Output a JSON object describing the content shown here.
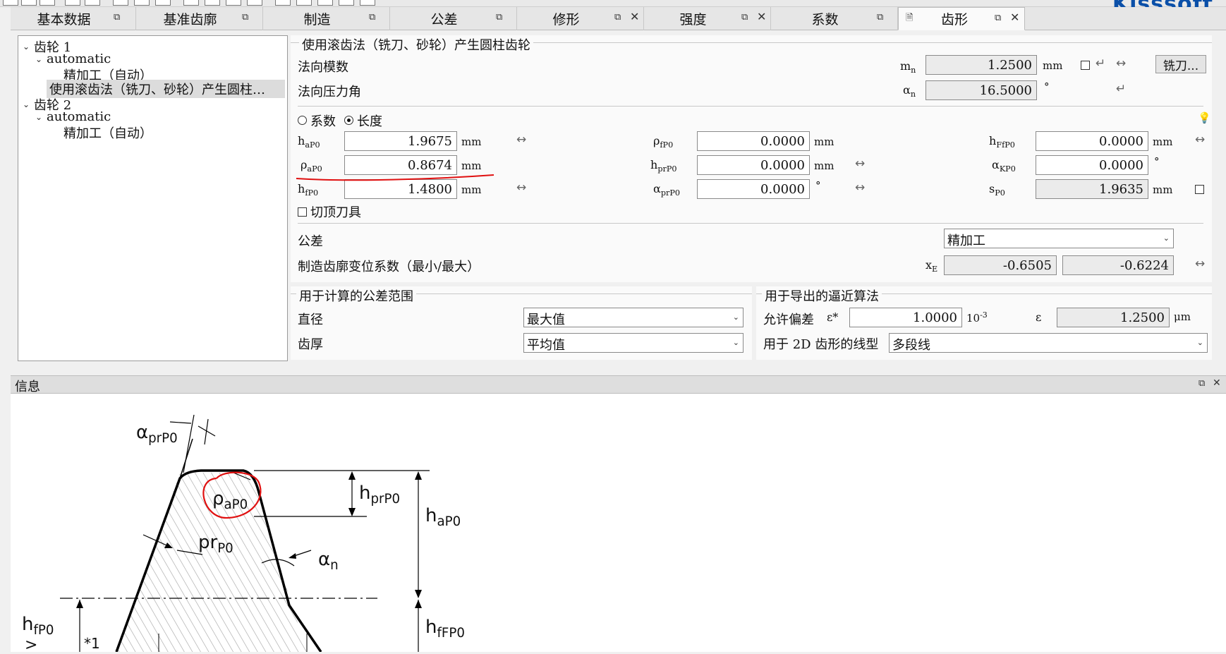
{
  "window": {
    "logo": "Kisssoft"
  },
  "tabs": [
    {
      "label": "基本数据",
      "float": true,
      "close": false
    },
    {
      "label": "基准齿廓",
      "float": true,
      "close": false
    },
    {
      "label": "制造",
      "float": true,
      "close": false
    },
    {
      "label": "公差",
      "float": true,
      "close": false
    },
    {
      "label": "修形",
      "float": true,
      "close": true
    },
    {
      "label": "强度",
      "float": true,
      "close": true
    },
    {
      "label": "系数",
      "float": true,
      "close": false
    },
    {
      "label": "齿形",
      "float": true,
      "close": true,
      "active": true
    }
  ],
  "tree": {
    "gear1": "齿轮 1",
    "auto1": "automatic",
    "fin1": "精加工（自动）",
    "hob1": "使用滚齿法（铣刀、砂轮）产生圆柱…",
    "gear2": "齿轮 2",
    "auto2": "automatic",
    "fin2": "精加工（自动）"
  },
  "main": {
    "group_title": "使用滚齿法（铣刀、砂轮）产生圆柱齿轮",
    "normal_module": {
      "label": "法向模数",
      "symbol": "m",
      "sub": "n",
      "value": "1.2500",
      "unit": "mm"
    },
    "pressure_angle": {
      "label": "法向压力角",
      "symbol": "α",
      "sub": "n",
      "value": "16.5000",
      "unit": "°"
    },
    "cutter_button": "铣刀...",
    "mode": {
      "coef": "系数",
      "length": "长度",
      "selected": "length"
    },
    "params": {
      "haP0": {
        "symbol": "h",
        "sub": "aP0",
        "value": "1.9675",
        "unit": "mm"
      },
      "rhoaP0": {
        "symbol": "ρ",
        "sub": "aP0",
        "value": "0.8674",
        "unit": "mm"
      },
      "hfP0": {
        "symbol": "h",
        "sub": "fP0",
        "value": "1.4800",
        "unit": "mm"
      },
      "rhofP0": {
        "symbol": "ρ",
        "sub": "fP0",
        "value": "0.0000",
        "unit": "mm"
      },
      "hprP0": {
        "symbol": "h",
        "sub": "prP0",
        "value": "0.0000",
        "unit": "mm"
      },
      "alphaprP0": {
        "symbol": "α",
        "sub": "prP0",
        "value": "0.0000",
        "unit": "°"
      },
      "hFfP0": {
        "symbol": "h",
        "sub": "FfP0",
        "value": "0.0000",
        "unit": "mm"
      },
      "alphaKP0": {
        "symbol": "α",
        "sub": "KP0",
        "value": "0.0000",
        "unit": "°"
      },
      "sP0": {
        "symbol": "s",
        "sub": "P0",
        "value": "1.9635",
        "unit": "mm"
      }
    },
    "tip_relief": "切顶刀具",
    "tolerance": {
      "label": "公差",
      "value": "精加工"
    },
    "shift": {
      "label": "制造齿廓变位系数（最小/最大）",
      "symbol": "x",
      "sub": "E",
      "min": "-0.6505",
      "max": "-0.6224"
    }
  },
  "tolerance_range": {
    "title": "用于计算的公差范围",
    "diameter": {
      "label": "直径",
      "value": "最大值"
    },
    "thickness": {
      "label": "齿厚",
      "value": "平均值"
    }
  },
  "approx": {
    "title": "用于导出的逼近算法",
    "deviation": {
      "label": "允许偏差",
      "symbol": "ε*",
      "value": "1.0000",
      "unit_base": "10",
      "unit_exp": "-3"
    },
    "eps": {
      "symbol": "ε",
      "value": "1.2500",
      "unit": "μm"
    },
    "linetype": {
      "label": "用于 2D 齿形的线型",
      "value": "多段线"
    }
  },
  "info": {
    "title": "信息",
    "diagram": {
      "alpha_prP0": {
        "base": "α",
        "sub": "prP0"
      },
      "rho_aP0": {
        "base": "ρ",
        "sub": "aP0"
      },
      "pr_P0": {
        "base": "pr",
        "sub": "P0"
      },
      "h_prP0": {
        "base": "h",
        "sub": "prP0"
      },
      "h_aP0": {
        "base": "h",
        "sub": "aP0"
      },
      "alpha_n": {
        "base": "α",
        "sub": "n"
      },
      "h_fP0": {
        "base": "h",
        "sub": "fP0"
      },
      "h_fFP0": {
        "base": "h",
        "sub": "fFP0"
      },
      "gt": ">",
      "star1": "*1"
    }
  },
  "colors": {
    "accent": "#0a4fa8",
    "annotation": "#e01010"
  }
}
